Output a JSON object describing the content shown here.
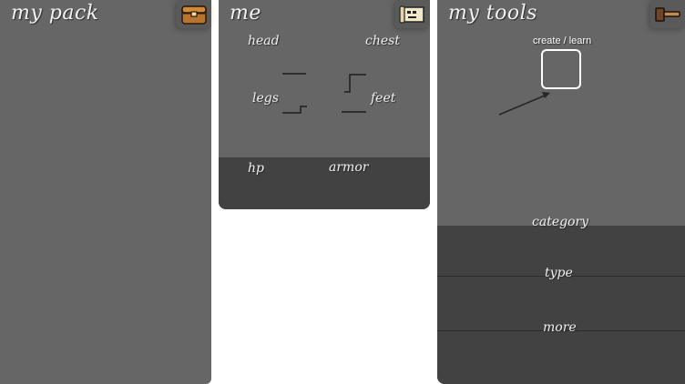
{
  "pack": {
    "title": "my pack",
    "icon": "chest-icon"
  },
  "me": {
    "title": "me",
    "icon": "scroll-icon",
    "slots": {
      "head": "head",
      "chest": "chest",
      "legs": "legs",
      "feet": "feet"
    },
    "stats": {
      "hp": "hp",
      "armor": "armor"
    }
  },
  "tools": {
    "title": "my tools",
    "icon": "hammer-icon",
    "create_label": "create / learn",
    "category": "category",
    "type": "type",
    "more": "more"
  }
}
